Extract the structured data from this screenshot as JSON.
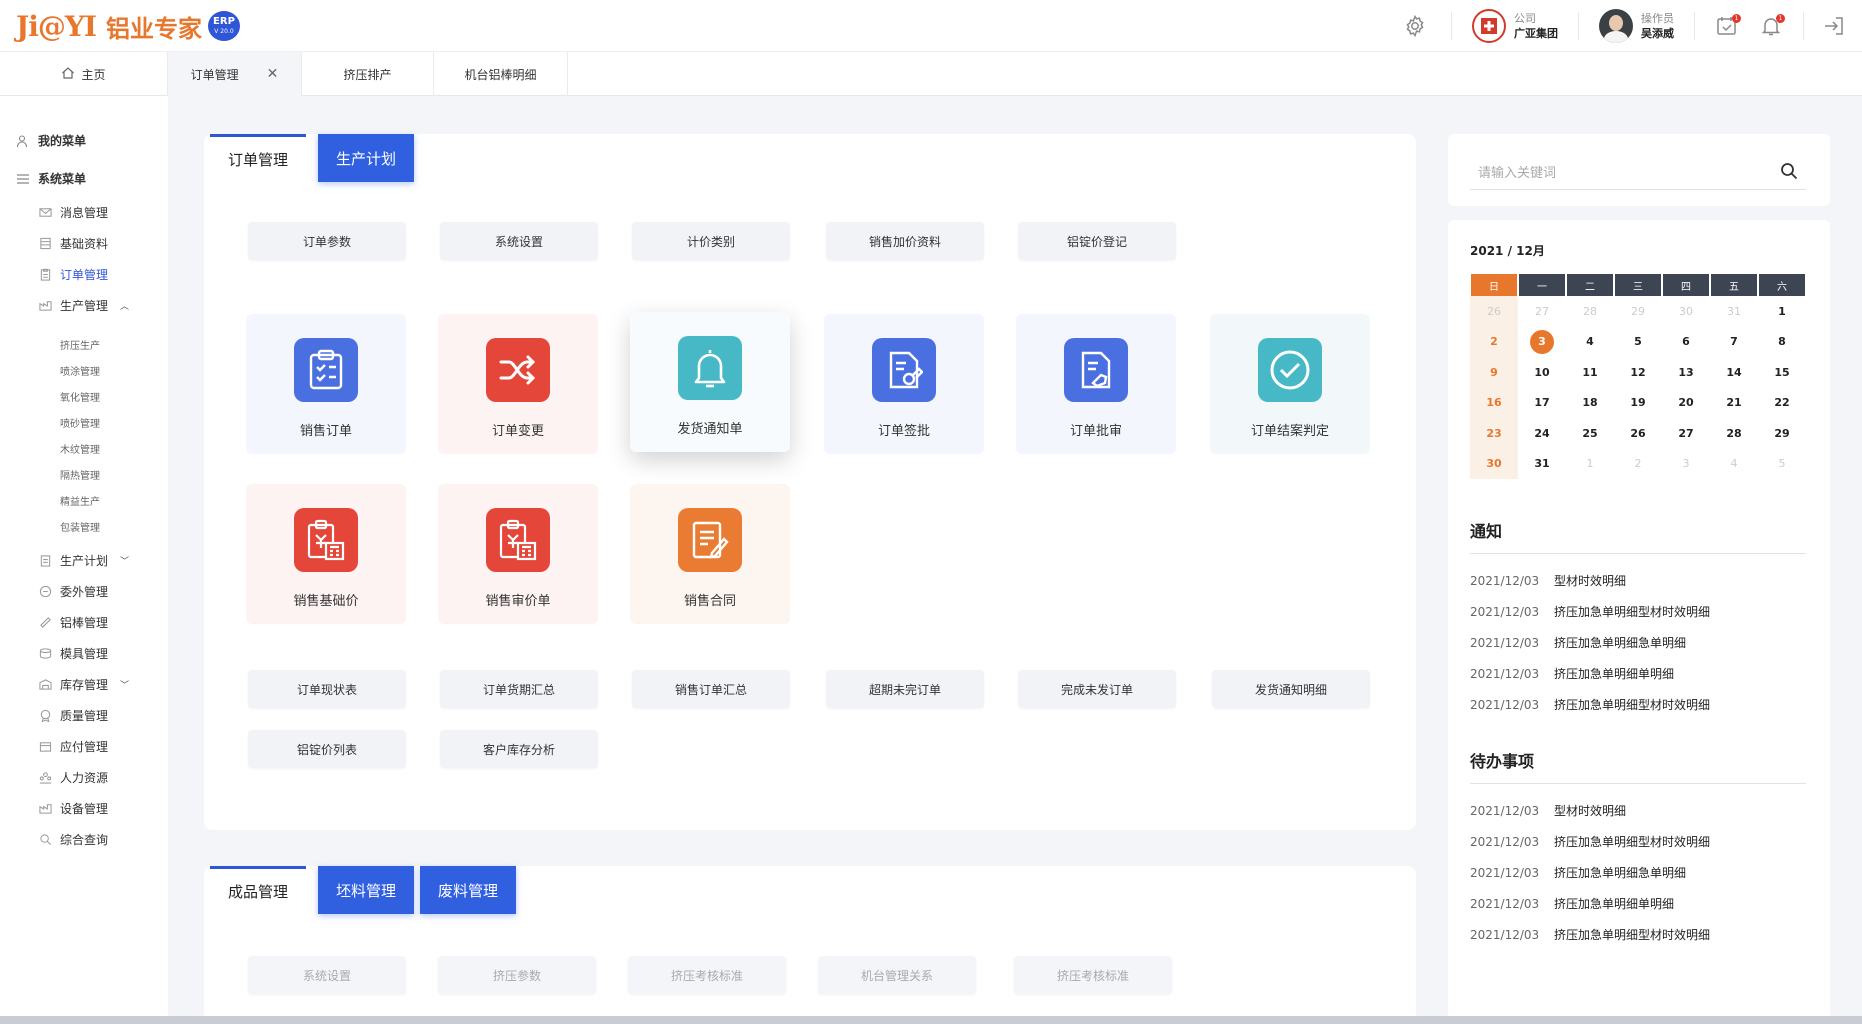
{
  "brand": {
    "mark": "Ji@YI",
    "title": "铝业专家",
    "badge_a": "ERP",
    "badge_b": "V 20.0"
  },
  "header": {
    "company_key": "公司",
    "company_val": "广亚集团",
    "user_key": "操作员",
    "user_val": "吴添威",
    "calendar_badge": "1",
    "bell_badge": "1"
  },
  "tabs": [
    {
      "label": "主页"
    },
    {
      "label": "订单管理"
    },
    {
      "label": "挤压排产"
    },
    {
      "label": "机台铝棒明细"
    }
  ],
  "sidebar": {
    "my_menu": "我的菜单",
    "sys_menu": "系统菜单",
    "items": [
      "消息管理",
      "基础资料",
      "订单管理",
      "生产管理"
    ],
    "sub": [
      "挤压生产",
      "喷涂管理",
      "氧化管理",
      "喷砂管理",
      "木纹管理",
      "隔热管理",
      "精益生产",
      "包装管理"
    ],
    "items2": [
      "生产计划",
      "委外管理",
      "铝棒管理",
      "模具管理",
      "库存管理",
      "质量管理",
      "应付管理",
      "人力资源",
      "设备管理",
      "综合查询"
    ]
  },
  "section1": {
    "tabs": [
      "订单管理",
      "生产计划"
    ],
    "chips_top": [
      "订单参数",
      "系统设置",
      "计价类别",
      "销售加价资料",
      "铝锭价登记"
    ],
    "cards_row1": [
      "销售订单",
      "订单变更",
      "发货通知单",
      "订单签批",
      "订单批审",
      "订单结案判定"
    ],
    "cards_row2": [
      "销售基础价",
      "销售审价单",
      "销售合同"
    ],
    "chips_bottom1": [
      "订单现状表",
      "订单货期汇总",
      "销售订单汇总",
      "超期未完订单",
      "完成未发订单",
      "发货通知明细"
    ],
    "chips_bottom2": [
      "铝锭价列表",
      "客户库存分析"
    ]
  },
  "section2": {
    "tabs": [
      "成品管理",
      "坯料管理",
      "废料管理"
    ],
    "chips": [
      "系统设置",
      "挤压参数",
      "挤压考核标准",
      "机台管理关系",
      "挤压考核标准"
    ]
  },
  "search": {
    "placeholder": "请输入关键词"
  },
  "calendar": {
    "year": "2021",
    "month": "12月",
    "weekdays": [
      "日",
      "一",
      "二",
      "三",
      "四",
      "五",
      "六"
    ],
    "days": [
      "26",
      "27",
      "28",
      "29",
      "30",
      "31",
      "1",
      "2",
      "3",
      "4",
      "5",
      "6",
      "7",
      "8",
      "9",
      "10",
      "11",
      "12",
      "13",
      "14",
      "15",
      "16",
      "17",
      "18",
      "19",
      "20",
      "21",
      "22",
      "23",
      "24",
      "25",
      "26",
      "27",
      "28",
      "29",
      "30",
      "31",
      "1",
      "2",
      "3",
      "4",
      "5"
    ]
  },
  "notices": {
    "title": "通知",
    "items": [
      {
        "date": "2021/12/03",
        "text": "型材时效明细"
      },
      {
        "date": "2021/12/03",
        "text": "挤压加急单明细型材时效明细"
      },
      {
        "date": "2021/12/03",
        "text": "挤压加急单明细急单明细"
      },
      {
        "date": "2021/12/03",
        "text": "挤压加急单明细单明细"
      },
      {
        "date": "2021/12/03",
        "text": "挤压加急单明细型材时效明细"
      }
    ]
  },
  "todos": {
    "title": "待办事项",
    "items": [
      {
        "date": "2021/12/03",
        "text": "型材时效明细"
      },
      {
        "date": "2021/12/03",
        "text": "挤压加急单明细型材时效明细"
      },
      {
        "date": "2021/12/03",
        "text": "挤压加急单明细急单明细"
      },
      {
        "date": "2021/12/03",
        "text": "挤压加急单明细单明细"
      },
      {
        "date": "2021/12/03",
        "text": "挤压加急单明细型材时效明细"
      }
    ]
  },
  "colors": {
    "accent": "#3060e0",
    "brand": "#e8772e"
  }
}
